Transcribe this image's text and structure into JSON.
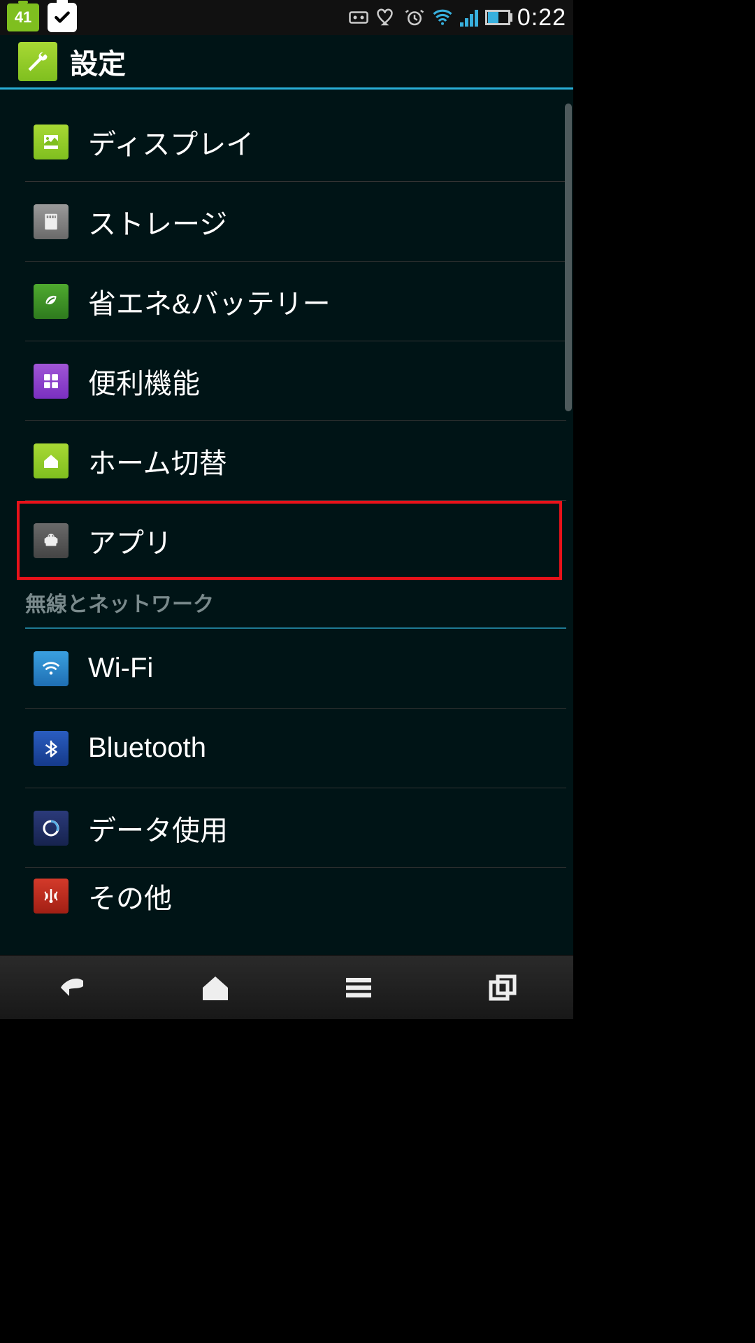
{
  "status_bar": {
    "battery_percent": "41",
    "time": "0:22"
  },
  "header": {
    "title": "設定"
  },
  "settings": {
    "items": [
      {
        "label": "ディスプレイ",
        "icon": "display-icon"
      },
      {
        "label": "ストレージ",
        "icon": "storage-icon"
      },
      {
        "label": "省エネ&バッテリー",
        "icon": "battery-icon"
      },
      {
        "label": "便利機能",
        "icon": "feature-icon"
      },
      {
        "label": "ホーム切替",
        "icon": "home-switch-icon"
      },
      {
        "label": "アプリ",
        "icon": "apps-icon",
        "highlighted": true
      }
    ],
    "section_header": "無線とネットワーク",
    "network_items": [
      {
        "label": "Wi-Fi",
        "icon": "wifi-icon"
      },
      {
        "label": "Bluetooth",
        "icon": "bluetooth-icon"
      },
      {
        "label": "データ使用",
        "icon": "data-usage-icon"
      },
      {
        "label": "その他",
        "icon": "other-icon"
      }
    ]
  }
}
